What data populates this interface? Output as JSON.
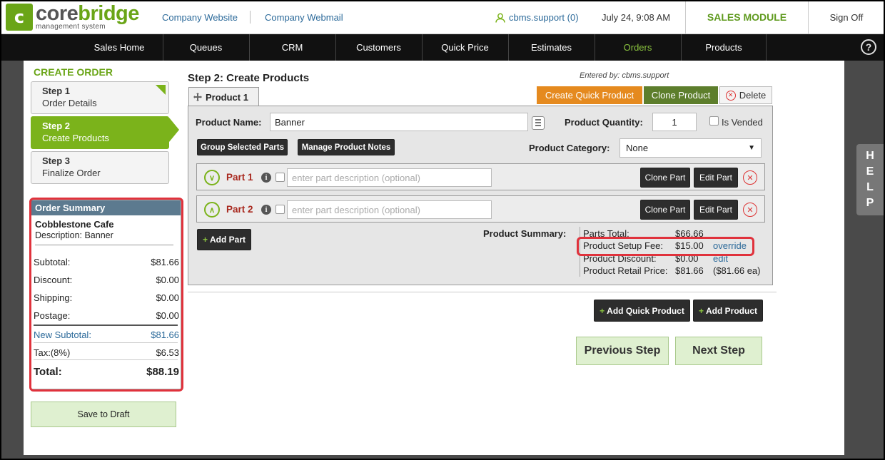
{
  "header": {
    "logo_name_a": "core",
    "logo_name_b": "bridge",
    "logo_sub": "management system",
    "links": [
      "Company Website",
      "Company Webmail"
    ],
    "user": "cbms.support (0)",
    "datetime": "July 24, 9:08 AM",
    "module": "SALES MODULE",
    "sign_off": "Sign Off"
  },
  "nav": {
    "items": [
      "Sales Home",
      "Queues",
      "CRM",
      "Customers",
      "Quick Price",
      "Estimates",
      "Orders",
      "Products"
    ],
    "active": "Orders",
    "help_icon": "?"
  },
  "help_tab": [
    "H",
    "E",
    "L",
    "P"
  ],
  "sidebar": {
    "title": "CREATE ORDER",
    "steps": [
      {
        "title": "Step 1",
        "subtitle": "Order Details"
      },
      {
        "title": "Step 2",
        "subtitle": "Create Products"
      },
      {
        "title": "Step 3",
        "subtitle": "Finalize Order"
      }
    ],
    "summary": {
      "heading": "Order Summary",
      "customer": "Cobblestone Cafe",
      "description": "Description:  Banner",
      "rows": [
        {
          "label": "Subtotal:",
          "value": "$81.66"
        },
        {
          "label": "Discount:",
          "value": "$0.00"
        },
        {
          "label": "Shipping:",
          "value": "$0.00"
        },
        {
          "label": "Postage:",
          "value": "$0.00"
        },
        {
          "label": "New Subtotal:",
          "value": "$81.66"
        },
        {
          "label": "Tax:(8%)",
          "value": "$6.53"
        },
        {
          "label": "Total:",
          "value": "$88.19"
        }
      ]
    },
    "save_draft": "Save to Draft"
  },
  "main": {
    "title": "Step 2: Create Products",
    "entered_by": "Entered by: cbms.support",
    "product_tab": "Product 1",
    "buttons": {
      "create_quick": "Create Quick Product",
      "clone_product": "Clone Product",
      "delete": "Delete",
      "group_parts": "Group Selected Parts",
      "manage_notes": "Manage Product Notes",
      "add_part": "Add Part",
      "add_quick_product": "Add Quick Product",
      "add_product": "Add Product",
      "previous_step": "Previous Step",
      "next_step": "Next Step"
    },
    "product_name_label": "Product Name:",
    "product_name_value": "Banner",
    "quantity_label": "Product Quantity:",
    "quantity_value": "1",
    "is_vended": "Is Vended",
    "category_label": "Product Category:",
    "category_value": "None",
    "parts": [
      {
        "label": "Part 1",
        "placeholder": "enter part description (optional)",
        "clone": "Clone Part",
        "edit": "Edit Part"
      },
      {
        "label": "Part 2",
        "placeholder": "enter part description (optional)",
        "clone": "Clone Part",
        "edit": "Edit Part"
      }
    ],
    "product_summary": {
      "label": "Product Summary:",
      "parts_total_label": "Parts Total:",
      "parts_total": "$66.66",
      "setup_fee_label": "Product Setup Fee:",
      "setup_fee": "$15.00",
      "override": "override",
      "discount_label": "Product Discount:",
      "discount": "$0.00",
      "edit": "edit",
      "retail_label": "Product Retail Price:",
      "retail": "$81.66",
      "retail_each": "($81.66 ea)"
    }
  }
}
